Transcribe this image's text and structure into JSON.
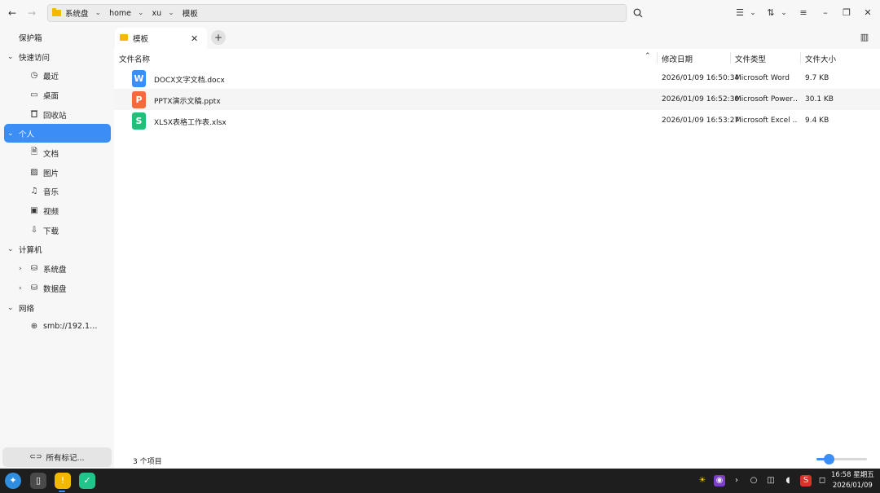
{
  "toolbar": {
    "back_icon": "←",
    "forward_icon": "→",
    "breadcrumbs": [
      "系统盘",
      "home",
      "xu",
      "模板"
    ],
    "search_icon": "search-icon",
    "view_list_icon": "☰",
    "sort_icon": "⇅",
    "menu_icon": "≡",
    "minimize_icon": "–",
    "restore_icon": "❐",
    "close_icon": "✕"
  },
  "sidebar": {
    "items": [
      {
        "label": "保护箱",
        "type": "top"
      },
      {
        "label": "快速访问",
        "type": "group"
      },
      {
        "label": "最近",
        "type": "child",
        "icon": "◷"
      },
      {
        "label": "桌面",
        "type": "child",
        "icon": "▭"
      },
      {
        "label": "回收站",
        "type": "child",
        "icon": "🗑"
      },
      {
        "label": "个人",
        "type": "group",
        "active": true
      },
      {
        "label": "文档",
        "type": "child",
        "icon": "🗎"
      },
      {
        "label": "图片",
        "type": "child",
        "icon": "▨"
      },
      {
        "label": "音乐",
        "type": "child",
        "icon": "♫"
      },
      {
        "label": "视频",
        "type": "child",
        "icon": "▣"
      },
      {
        "label": "下载",
        "type": "child",
        "icon": "⇩"
      },
      {
        "label": "计算机",
        "type": "group"
      },
      {
        "label": "系统盘",
        "type": "child-exp",
        "icon": "⛁"
      },
      {
        "label": "数据盘",
        "type": "child-exp",
        "icon": "⛁"
      },
      {
        "label": "网络",
        "type": "group"
      },
      {
        "label": "smb://192.1…",
        "type": "child",
        "icon": "⊕"
      }
    ],
    "tag_button": "所有标记..."
  },
  "tabs": [
    {
      "label": "模板"
    }
  ],
  "columns": {
    "name": "文件名称",
    "modified": "修改日期",
    "type": "文件类型",
    "size": "文件大小"
  },
  "files": [
    {
      "name": "DOCX文字文档.docx",
      "modified": "2026/01/09 16:50:34",
      "type": "Microsoft Word",
      "size": "9.7 KB",
      "icon_color": "#3a8ef6",
      "icon_letter": "W"
    },
    {
      "name": "PPTX演示文稿.pptx",
      "modified": "2026/01/09 16:52:30",
      "type": "Microsoft Power…",
      "size": "30.1 KB",
      "icon_color": "#f26a3d",
      "icon_letter": "P"
    },
    {
      "name": "XLSX表格工作表.xlsx",
      "modified": "2026/01/09 16:53:27",
      "type": "Microsoft Excel …",
      "size": "9.4 KB",
      "icon_color": "#1ec07a",
      "icon_letter": "S"
    }
  ],
  "status": {
    "item_count": "3 个项目",
    "zoom_level": 0.25
  },
  "taskbar": {
    "time": "16:58 星期五",
    "date": "2026/01/09"
  }
}
